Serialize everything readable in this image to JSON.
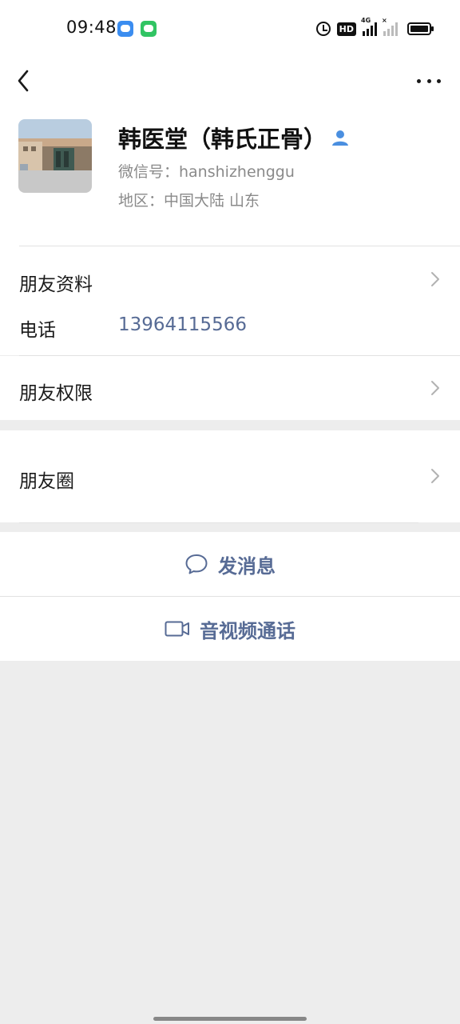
{
  "status_bar": {
    "time": "09:48",
    "hd_label": "HD",
    "network_label": "4G",
    "sim2_label": "×"
  },
  "contact": {
    "name": "韩医堂（韩氏正骨）",
    "wechat_id": "微信号：hanshizhenggu",
    "region": "地区：中国大陆  山东"
  },
  "menu": {
    "friend_profile_label": "朋友资料",
    "phone_label": "电话",
    "phone_value": "13964115566",
    "friend_permissions_label": "朋友权限",
    "moments_label": "朋友圈"
  },
  "actions": {
    "send_message_label": "发消息",
    "video_call_label": "音视频通话"
  },
  "colors": {
    "link": "#576b95",
    "page_background": "#ededed",
    "verified_icon": "#4a8fe0"
  }
}
